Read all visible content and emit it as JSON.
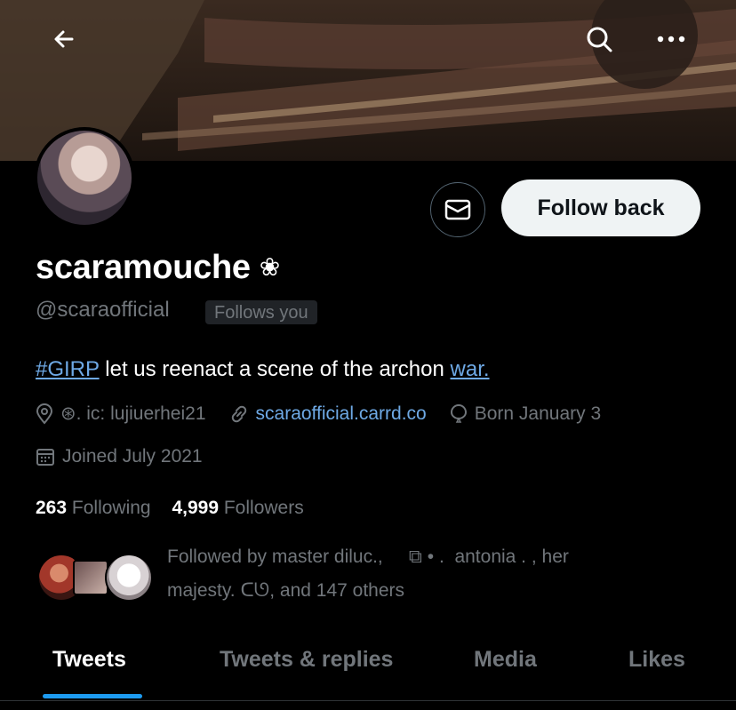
{
  "header": {
    "back_icon": "arrow-left-icon",
    "search_icon": "search-icon",
    "more_icon": "more-horizontal-icon"
  },
  "profile": {
    "name": "scaramouche",
    "name_emoji": "❀",
    "handle": "@scaraofficial",
    "follows_you_badge": "Follows you",
    "bio_hashtag": "#GIRP",
    "bio_text": " let us reenact a scene of the archon ",
    "bio_link": "war.   ",
    "location": "⊛. ic: lujiuerhei21",
    "website": "scaraofficial.carrd.co",
    "birthday": "Born January 3",
    "joined": "Joined July 2021"
  },
  "actions": {
    "follow_back_label": "Follow back",
    "message_icon": "mail-icon"
  },
  "stats": {
    "following_count": "263",
    "following_label": "Following",
    "followers_count": "4,999",
    "followers_label": "Followers"
  },
  "followed_by": {
    "line1": "Followed by master diluc.,     ⧉ • .  antonia . , her",
    "line2": "majesty. ᑕᘎ, and 147 others"
  },
  "tabs": [
    {
      "label": "Tweets",
      "active": true
    },
    {
      "label": "Tweets & replies",
      "active": false
    },
    {
      "label": "Media",
      "active": false
    },
    {
      "label": "Likes",
      "active": false
    }
  ],
  "colors": {
    "accent": "#1d9bf0",
    "link": "#6ea9e5",
    "muted": "#71767b",
    "background": "#000000"
  }
}
